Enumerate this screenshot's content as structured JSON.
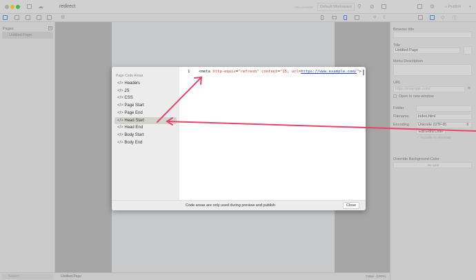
{
  "toolbar": {
    "document_title": "redirect",
    "license": "PRO LICENSE",
    "workspace": "Default Workspace",
    "publish": "Publish"
  },
  "left": {
    "pages_label": "Pages",
    "page_item": "Untitled Page",
    "search_placeholder": "Search"
  },
  "bottom": {
    "page_name": "Untitled Page",
    "size": "748px",
    "zoom": "(100%)"
  },
  "right": {
    "browser_title_label": "Browser title",
    "browser_title_value": "",
    "title_label": "Title",
    "title_value": "Untitled Page",
    "menu_desc_label": "Menu Description",
    "url_label": "URL",
    "url_placeholder": "https://example.com/",
    "open_new_window": "Open in new window",
    "folder_label": "Folder",
    "filename_label": "Filename",
    "filename_value": "index.html",
    "encoding_label": "Encoding",
    "encoding_value": "Unicode (UTF-8)",
    "edit_extra_code": "Edit Extra Code",
    "include_sitemap": "Include in sitemap",
    "override_bg_label": "Override Background Color",
    "bg_value": "No color"
  },
  "modal": {
    "section_title": "Page Code Areas",
    "items": [
      "Headers",
      "JS",
      "CSS",
      "Page Start",
      "Page End",
      "Head Start",
      "Head End",
      "Body Start",
      "Body End"
    ],
    "selected": "Head Start",
    "line_number": "1",
    "code": {
      "p1": "<meta ",
      "a1": "http-equiv",
      "p2": "=",
      "s1": "\"refresh\"",
      "p3": " ",
      "a2": "content",
      "p4": "=",
      "s2": "\"15; url=",
      "u": "https://www.example.com/",
      "s3": "\"",
      "p5": ">"
    },
    "footer_note": "Code areas are only used during preview and publish",
    "close": "Close"
  },
  "colors": {
    "arrow": "#e8436b"
  }
}
